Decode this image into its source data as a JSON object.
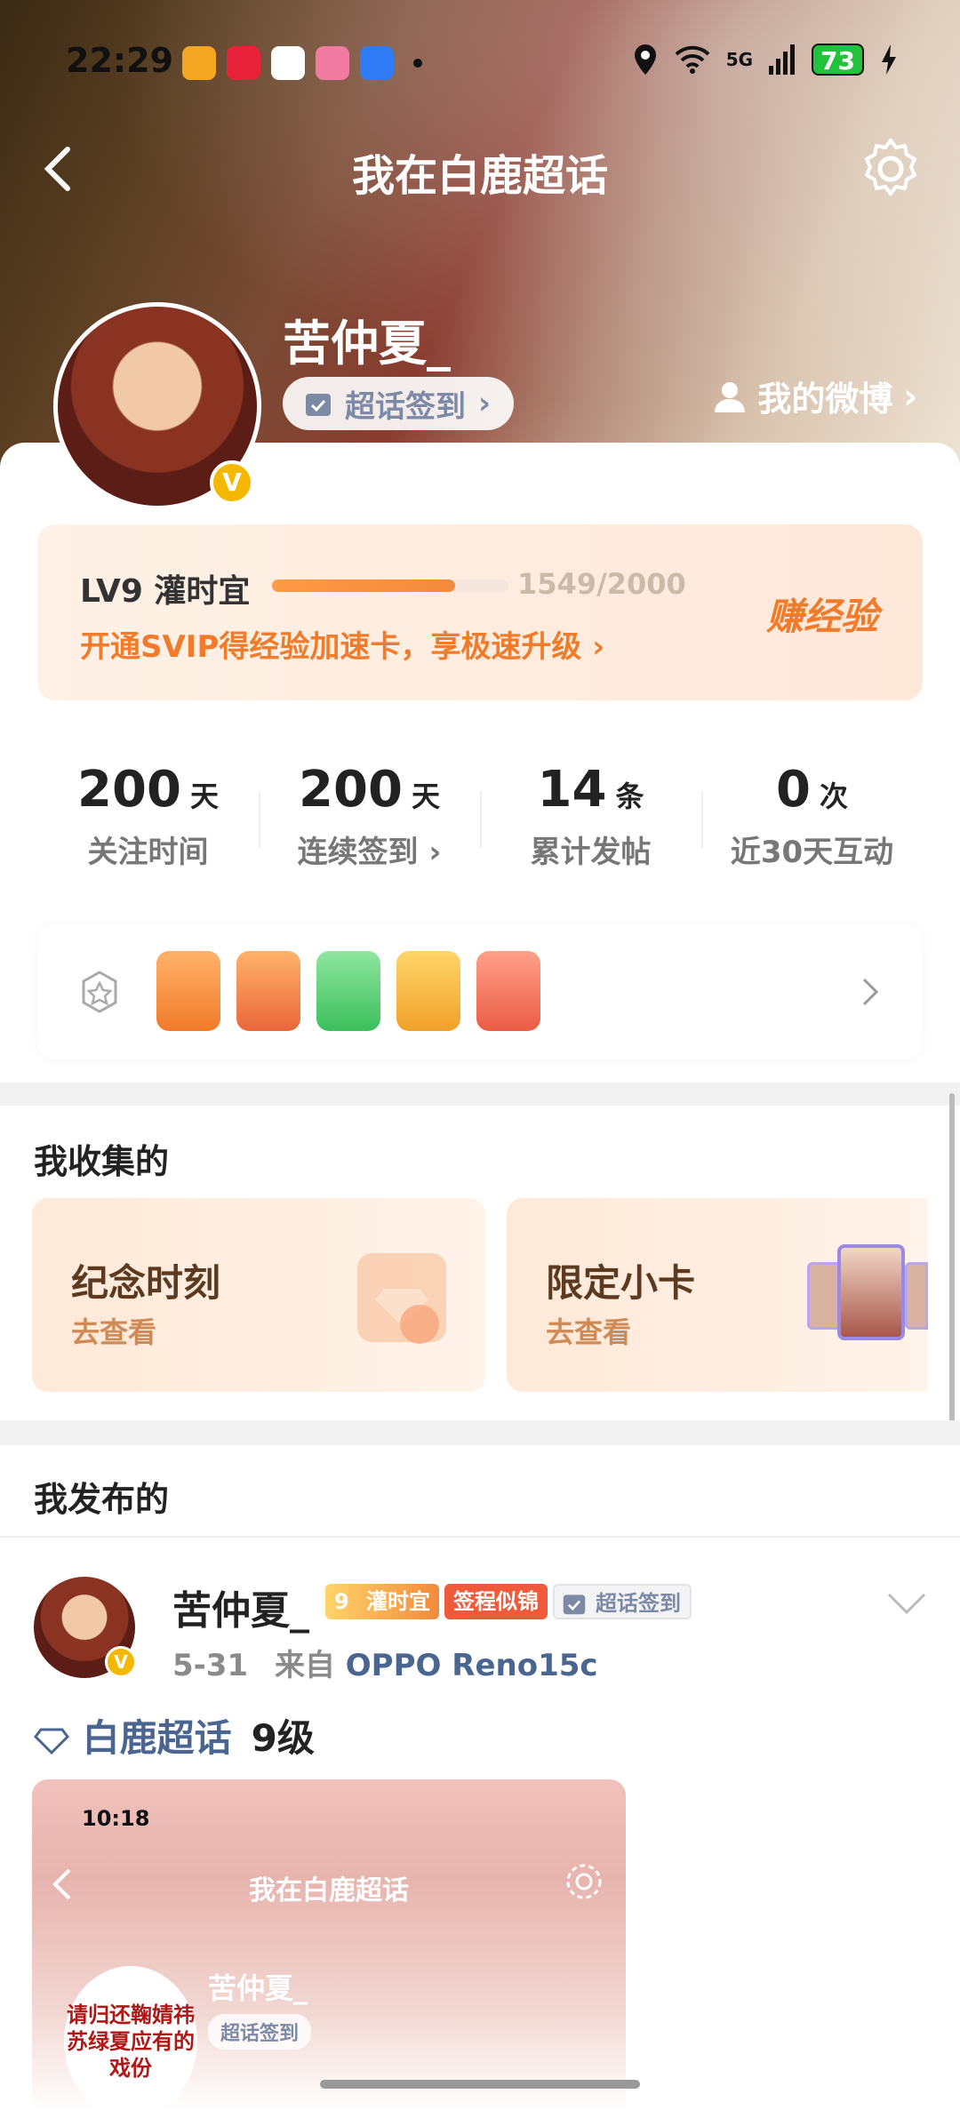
{
  "status_bar": {
    "time": "22:29",
    "network": "5G",
    "battery": "73"
  },
  "header": {
    "title": "我在白鹿超话"
  },
  "profile": {
    "name": "苦仲夏_",
    "checkin_label": "超话签到",
    "my_weibo_label": "我的微博"
  },
  "level": {
    "level_label": "LV9 灌时宜",
    "progress_text": "1549/2000",
    "progress_fraction": 0.7745,
    "promo": "开通SVIP得经验加速卡，享极速升级",
    "earn_label": "赚经验"
  },
  "stats": [
    {
      "value": "200",
      "unit": "天",
      "label": "关注时间"
    },
    {
      "value": "200",
      "unit": "天",
      "label": "连续签到"
    },
    {
      "value": "14",
      "unit": "条",
      "label": "累计发帖"
    },
    {
      "value": "0",
      "unit": "次",
      "label": "近30天互动"
    }
  ],
  "collected": {
    "title": "我收集的",
    "cards": [
      {
        "title": "纪念时刻",
        "sub": "去查看"
      },
      {
        "title": "限定小卡",
        "sub": "去查看"
      }
    ]
  },
  "published": {
    "title": "我发布的"
  },
  "post": {
    "author": "苦仲夏_",
    "tags": [
      "灌时宜",
      "签程似锦",
      "超话签到"
    ],
    "level_num": "9",
    "date": "5-31",
    "from_label": "来自",
    "device": "OPPO Reno15c",
    "topic": "白鹿超话",
    "topic_level": "9级"
  },
  "screenshot_preview": {
    "time": "10:18",
    "title": "我在白鹿超话",
    "name": "苦仲夏_",
    "checkin": "超话签到",
    "circle_text": "请归还鞠婧祎苏绿夏应有的戏份"
  },
  "colors": {
    "accent": "#f07b2a",
    "link": "#4a6690",
    "vip": "#f5b800"
  }
}
